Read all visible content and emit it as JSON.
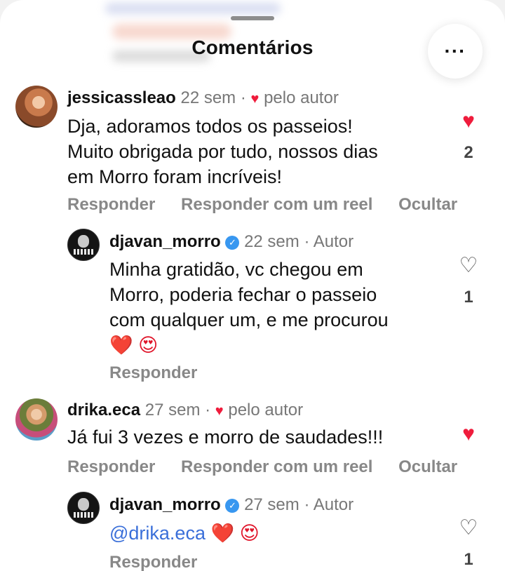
{
  "header": {
    "title": "Comentários",
    "more_label": "···"
  },
  "comments": [
    {
      "username": "jessicassleao",
      "time": "22 sem",
      "separator": "·",
      "liked_by_author": "pelo autor",
      "lines": [
        "Dja, adoramos todos os passeios!",
        "Muito obrigada por tudo, nossos dias",
        "em Morro foram incríveis!"
      ],
      "like_count": "2",
      "liked": true,
      "actions": [
        "Responder",
        "Responder com um reel",
        "Ocultar"
      ]
    },
    {
      "username": "drika.eca",
      "time": "27 sem",
      "separator": "·",
      "liked_by_author": "pelo autor",
      "lines": [
        "Já fui 3 vezes e morro de saudades!!!"
      ],
      "liked": true,
      "actions": [
        "Responder",
        "Responder com um reel",
        "Ocultar"
      ]
    }
  ],
  "replies": [
    {
      "username": "djavan_morro",
      "time": "22 sem",
      "separator": "·",
      "role": "Autor",
      "lines": [
        "Minha gratidão, vc chegou em",
        "Morro, poderia fechar o passeio",
        "com qualquer um, e me procurou"
      ],
      "emojis": "❤️ 😍",
      "like_count": "1",
      "liked": false,
      "action": "Responder"
    },
    {
      "username": "djavan_morro",
      "time": "27 sem",
      "separator": "·",
      "role": "Autor",
      "mention": "@drika.eca",
      "emojis": "❤️ 😍",
      "like_count": "1",
      "liked": false,
      "action": "Responder"
    }
  ],
  "icons": {
    "heart_filled": "♥",
    "heart_outline": "♡",
    "verified": "✓"
  },
  "colors": {
    "like_red": "#ef1c3c",
    "verified_blue": "#3897f0",
    "mention_blue": "#3a6fd9",
    "secondary_text": "#777777"
  }
}
